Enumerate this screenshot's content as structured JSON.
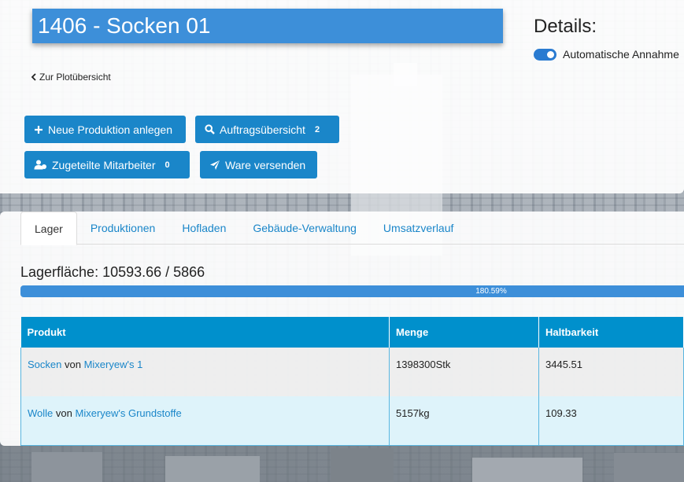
{
  "header": {
    "title": "1406 - Socken 01",
    "back_link": "Zur Plotübersicht"
  },
  "actions": {
    "new_production": "Neue Produktion anlegen",
    "order_overview": "Auftragsübersicht",
    "order_count": "2",
    "assigned_staff": "Zugeteilte Mitarbeiter",
    "staff_count": "0",
    "ship_goods": "Ware versenden"
  },
  "details": {
    "title": "Details:",
    "auto_accept_label": "Automatische Annahme",
    "auto_accept_on": true
  },
  "tabs": [
    {
      "label": "Lager",
      "active": true
    },
    {
      "label": "Produktionen"
    },
    {
      "label": "Hofladen"
    },
    {
      "label": "Gebäude-Verwaltung"
    },
    {
      "label": "Umsatzverlauf"
    }
  ],
  "storage": {
    "label": "Lagerfläche: 10593.66 / 5866",
    "percent_text": "180.59%",
    "percent": 180.59
  },
  "table": {
    "headers": [
      "Produkt",
      "Menge",
      "Haltbarkeit"
    ],
    "von": "von",
    "rows": [
      {
        "product": "Socken",
        "source": "Mixeryew's 1",
        "amount": "1398300Stk",
        "durability": "3445.51"
      },
      {
        "product": "Wolle",
        "source": "Mixeryew's Grundstoffe",
        "amount": "5157kg",
        "durability": "109.33"
      }
    ]
  },
  "colors": {
    "accent": "#3d8fd9",
    "button": "#1a86c9",
    "table_header": "#0090cc"
  }
}
